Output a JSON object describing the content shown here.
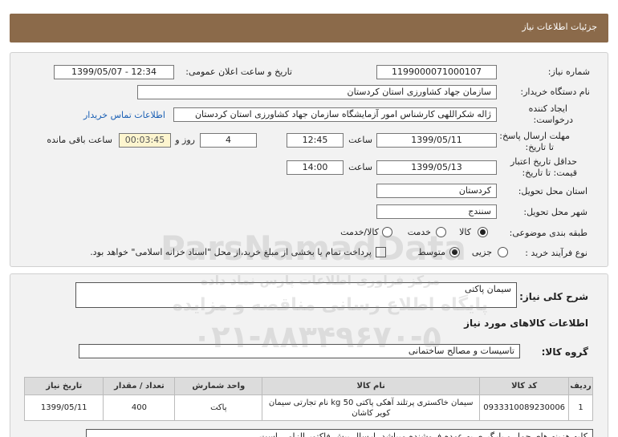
{
  "header": {
    "title": "جزئیات اطلاعات نیاز"
  },
  "form": {
    "need_number_label": "شماره نیاز:",
    "need_number": "1199000071000107",
    "announce_label": "تاریخ و ساعت اعلان عمومی:",
    "announce_value": "1399/05/07 - 12:34",
    "buyer_org_label": "نام دستگاه خریدار:",
    "buyer_org": "سازمان جهاد کشاورزی استان کردستان",
    "creator_label_1": "ایجاد کننده",
    "creator_label_2": "درخواست:",
    "creator": "ژاله شکراللهی کارشناس امور آزمایشگاه سازمان جهاد کشاورزی استان کردستان",
    "contact_link": "اطلاعات تماس خریدار",
    "send_deadline_label_1": "مهلت ارسال پاسخ:",
    "send_deadline_label_2": "تا تاریخ:",
    "send_date": "1399/05/11",
    "time_label": "ساعت",
    "send_time": "12:45",
    "days_value": "4",
    "days_label": "روز و",
    "countdown": "00:03:45",
    "remaining_label": "ساعت باقی مانده",
    "validity_label_1": "حداقل تاریخ اعتبار",
    "validity_label_2": "قیمت: تا تاریخ:",
    "validity_date": "1399/05/13",
    "validity_time": "14:00",
    "province_label": "استان محل تحویل:",
    "province": "کردستان",
    "city_label": "شهر محل تحویل:",
    "city": "سنندج",
    "category_label": "طبقه بندی موضوعی:",
    "category_options": [
      "کالا",
      "خدمت",
      "کالا/خدمت"
    ],
    "category_selected": "کالا",
    "process_label": "نوع فرآیند خرید :",
    "process_options": [
      "جزیی",
      "متوسط"
    ],
    "process_selected": "متوسط",
    "payment_note": "پرداخت تمام یا بخشی از مبلغ خرید،از محل \"اسناد خزانه اسلامی\" خواهد بود."
  },
  "details": {
    "summary_label": "شرح کلی نیاز:",
    "summary": "سیمان پاکتی",
    "goods_info_title": "اطلاعات کالاهای مورد نیاز",
    "goods_group_label": "گروه کالا:",
    "goods_group": "تاسیسات و مصالح ساختمانی",
    "table": {
      "headers": [
        "ردیف",
        "کد کالا",
        "نام کالا",
        "واحد شمارش",
        "تعداد / مقدار",
        "تاریخ نیاز"
      ],
      "rows": [
        [
          "1",
          "0933310089230006",
          "سیمان خاکستری پرتلند آهکی پاکتی 50 kg نام تجارتی سیمان کویر کاشان",
          "پاکت",
          "400",
          "1399/05/11"
        ]
      ]
    },
    "buyer_desc": "کلیه هزینه های حمل و بارگیری به عهده فروشنده میباشد. ارسال پیش فاکتور الزامی است"
  },
  "watermark": {
    "brand": "ParsNamadData",
    "line1": "مرکز فراوری اطلاعات پارس نماد داده",
    "line2": "پایگاه اطلاع رسانی مناقصه و مزایده",
    "phone": "۰۲۱-۸۸۳۴۹۶۷۰-۵"
  }
}
